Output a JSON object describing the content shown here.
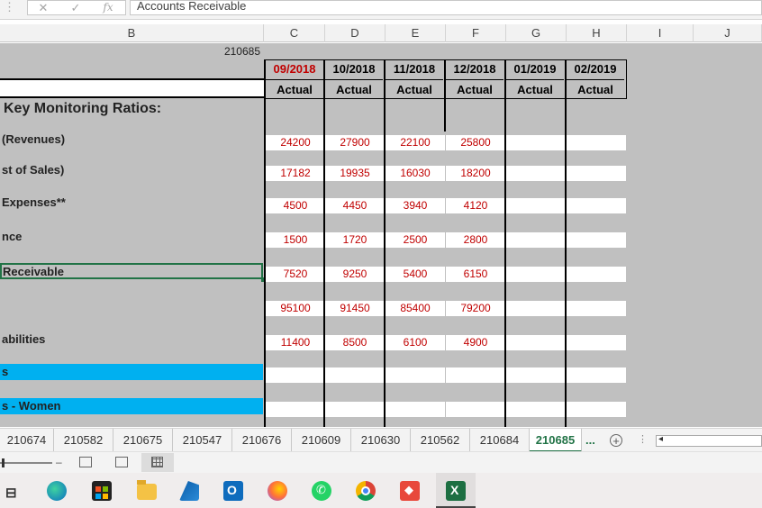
{
  "formula_bar": {
    "content": "Accounts Receivable",
    "cancel_glyph": "✕",
    "enter_glyph": "✓",
    "fx_glyph": "fx",
    "name_box_dots": "⋮"
  },
  "columns": [
    "B",
    "C",
    "D",
    "E",
    "F",
    "G",
    "H",
    "I",
    "J"
  ],
  "cell_b_top": "210685",
  "header_months": [
    "09/2018",
    "10/2018",
    "11/2018",
    "12/2018",
    "01/2019",
    "02/2019"
  ],
  "header_actual": [
    "Actual",
    "Actual",
    "Actual",
    "Actual",
    "Actual",
    "Actual"
  ],
  "section_title": "Key Monitoring Ratios:",
  "rows": [
    {
      "label": "(Revenues)",
      "values": [
        "24200",
        "27900",
        "22100",
        "25800",
        "",
        ""
      ]
    },
    {
      "label": "st of Sales)",
      "values": [
        "17182",
        "19935",
        "16030",
        "18200",
        "",
        ""
      ]
    },
    {
      "label": " Expenses**",
      "values": [
        "4500",
        "4450",
        "3940",
        "4120",
        "",
        ""
      ]
    },
    {
      "label": "nce",
      "values": [
        "1500",
        "1720",
        "2500",
        "2800",
        "",
        ""
      ]
    },
    {
      "label": "Receivable",
      "values": [
        "7520",
        "9250",
        "5400",
        "6150",
        "",
        ""
      ]
    },
    {
      "label": "",
      "values": [
        "95100",
        "91450",
        "85400",
        "79200",
        "",
        ""
      ]
    },
    {
      "label": "abilities",
      "values": [
        "11400",
        "8500",
        "6100",
        "4900",
        "",
        ""
      ]
    },
    {
      "label": "s",
      "values": [
        "",
        "",
        "",
        "",
        "",
        ""
      ]
    },
    {
      "label": "s - Women",
      "values": [
        "",
        "",
        "",
        "",
        "",
        ""
      ]
    }
  ],
  "sheet_tabs": [
    "210674",
    "210582",
    "210675",
    "210547",
    "210676",
    "210609",
    "210630",
    "210562",
    "210684",
    "210685"
  ],
  "active_sheet": "210685",
  "more_tabs": "...",
  "add_sheet_glyph": "+",
  "colors": {
    "accent_green": "#217346",
    "value_red": "#c00000",
    "highlight_blue": "#00b0f0",
    "grid_gray": "#c0c0c0"
  },
  "taskbar_icons": [
    "task-view-icon",
    "edge-icon",
    "store-icon",
    "file-explorer-icon",
    "azure-icon",
    "outlook-icon",
    "firefox-icon",
    "whatsapp-icon",
    "chrome-icon",
    "git-icon",
    "excel-icon"
  ]
}
